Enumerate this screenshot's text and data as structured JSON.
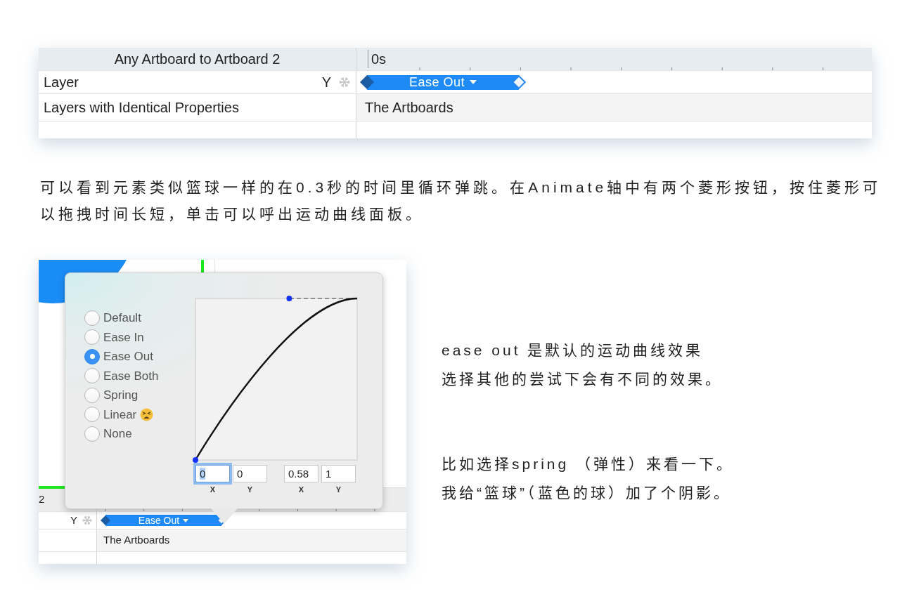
{
  "timeline_panel": {
    "title": "Any Artboard to Artboard 2",
    "time_label": "0s",
    "rows": [
      {
        "kind": "animation",
        "layer": "Layer",
        "property": "Y",
        "curve": "Ease Out"
      },
      {
        "kind": "target",
        "layer": "Layers with Identical Properties",
        "target": "The Artboards"
      }
    ]
  },
  "intro_paragraph": "可以看到元素类似篮球一样的在0.3秒的时间里循环弹跳。在Animate轴中有两个菱形按钮，按住菱形可以拖拽时间长短，单击可以呼出运动曲线面板。",
  "curve_editor_screenshot": {
    "timeline": {
      "title": "2",
      "rows": [
        {
          "kind": "animation",
          "property": "Y",
          "curve": "Ease Out"
        },
        {
          "kind": "target",
          "target": "The Artboards"
        }
      ]
    },
    "curve_popover": {
      "options": [
        {
          "label": "Default",
          "selected": false,
          "has_emoji": false
        },
        {
          "label": "Ease In",
          "selected": false,
          "has_emoji": false
        },
        {
          "label": "Ease Out",
          "selected": true,
          "has_emoji": false
        },
        {
          "label": "Ease Both",
          "selected": false,
          "has_emoji": false
        },
        {
          "label": "Spring",
          "selected": false,
          "has_emoji": false
        },
        {
          "label": "Linear",
          "selected": false,
          "has_emoji": true
        },
        {
          "label": "None",
          "selected": false,
          "has_emoji": false
        }
      ],
      "control_points": [
        {
          "fields": [
            {
              "axis": "X",
              "value": "0",
              "focused": true
            },
            {
              "axis": "Y",
              "value": "0",
              "focused": false
            }
          ]
        },
        {
          "fields": [
            {
              "axis": "X",
              "value": "0.58",
              "focused": false
            },
            {
              "axis": "Y",
              "value": "1",
              "focused": false
            }
          ]
        }
      ]
    }
  },
  "notes": [
    {
      "lines": [
        "ease out 是默认的运动曲线效果",
        "选择其他的尝试下会有不同的效果。"
      ]
    },
    {
      "lines": [
        "比如选择spring （弹性）来看一下。",
        "我给“篮球”（蓝色的球）加了个阴影。"
      ]
    }
  ]
}
